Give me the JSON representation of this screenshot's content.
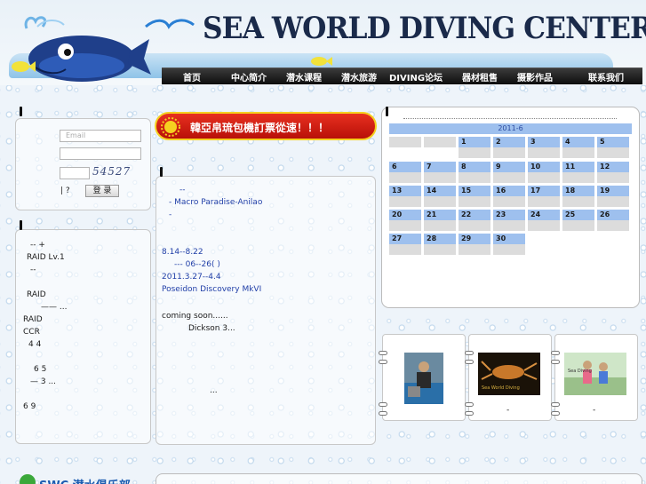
{
  "header": {
    "title": "SEA WORLD DIVING CENTER"
  },
  "nav": {
    "items": [
      "首页",
      "中心简介",
      "潜水课程",
      "潜水旅游",
      "DIVING论坛",
      "器材租售",
      "摄影作品",
      "联系我们"
    ]
  },
  "login": {
    "email_placeholder": "Email",
    "captcha": "54527",
    "links": "|    ?",
    "submit": "登 录"
  },
  "banner": {
    "text": "韓亞帛琉包機訂票從速！！！"
  },
  "left_news": [
    "-- +",
    "RAID  Lv.1",
    "--",
    "RAID",
    "——   ...",
    "RAID",
    "CCR",
    "4 4",
    "6 5",
    "—    3 ...",
    "6 9"
  ],
  "middle_news": [
    "--",
    "-   Macro Paradise-Anilao",
    "-",
    "8.14--8.22",
    "--- 06--26(    )",
    "2011.3.27--4.4",
    "Poseidon Discovery MkVI",
    "coming soon......",
    "Dickson   3...",
    "..."
  ],
  "calendar": {
    "month": "2011-6",
    "days": [
      "1",
      "2",
      "3",
      "4",
      "5",
      "6",
      "7",
      "8",
      "9",
      "10",
      "11",
      "12",
      "13",
      "14",
      "15",
      "16",
      "17",
      "18",
      "19",
      "20",
      "21",
      "22",
      "23",
      "24",
      "25",
      "26",
      "27",
      "28",
      "29",
      "30"
    ]
  },
  "photos": [
    {
      "name": "photo-diver-pool",
      "caption": ""
    },
    {
      "name": "photo-lobster",
      "caption": "-",
      "label": "Sea World Diving"
    },
    {
      "name": "photo-children",
      "caption": "-",
      "label": "Sea Diving"
    }
  ],
  "footer": {
    "logo_text": "SWC 潜水俱乐部"
  },
  "colors": {
    "nav_bg": "#1a1a1a",
    "calendar_blue": "#9ec0ee",
    "link_blue": "#2240a8",
    "banner_red": "#d41a10"
  }
}
